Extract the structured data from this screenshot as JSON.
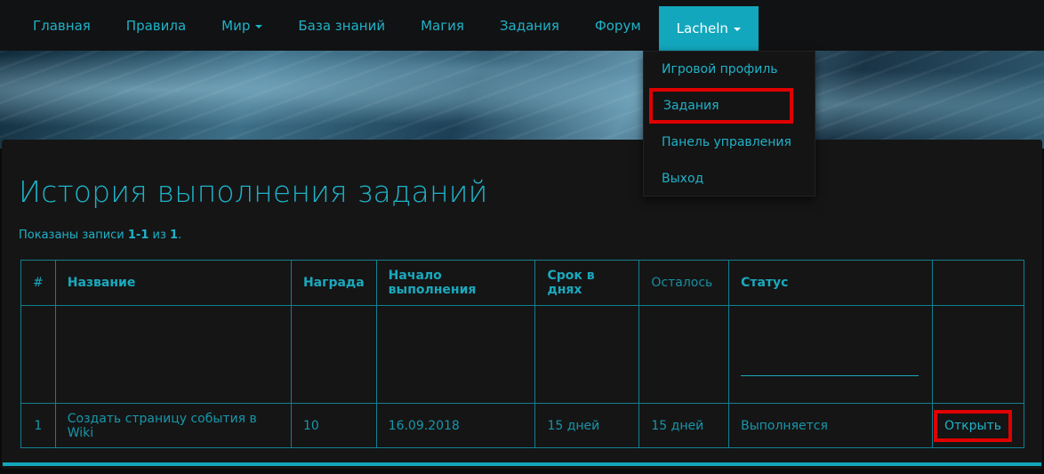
{
  "nav": {
    "items": [
      {
        "label": "Главная"
      },
      {
        "label": "Правила"
      },
      {
        "label": "Мир",
        "dropdown": true
      },
      {
        "label": "База знаний"
      },
      {
        "label": "Магия"
      },
      {
        "label": "Задания"
      },
      {
        "label": "Форум"
      }
    ],
    "user": {
      "label": "Lacheln",
      "dropdown": true
    }
  },
  "user_menu": {
    "items": [
      {
        "label": "Игровой профиль"
      },
      {
        "label": "Задания"
      },
      {
        "label": "Панель управления"
      },
      {
        "label": "Выход"
      }
    ]
  },
  "page": {
    "title": "История выполнения заданий",
    "summary_prefix": "Показаны записи ",
    "summary_range": "1-1",
    "summary_mid": " из ",
    "summary_total": "1",
    "summary_suffix": "."
  },
  "table": {
    "headers": [
      "#",
      "Название",
      "Награда",
      "Начало выполнения",
      "Срок в днях",
      "Осталось",
      "Статус",
      ""
    ],
    "rows": [
      {
        "num": "1",
        "name": "Создать страницу события в Wiki",
        "reward": "10",
        "start": "16.09.2018",
        "term": "15 дней",
        "left": "15 дней",
        "status": "Выполняется",
        "action": "Открыть"
      }
    ]
  },
  "colors": {
    "accent": "#12a7bd",
    "text": "#1fb2c8",
    "highlight": "#e00000",
    "background": "#151515"
  }
}
